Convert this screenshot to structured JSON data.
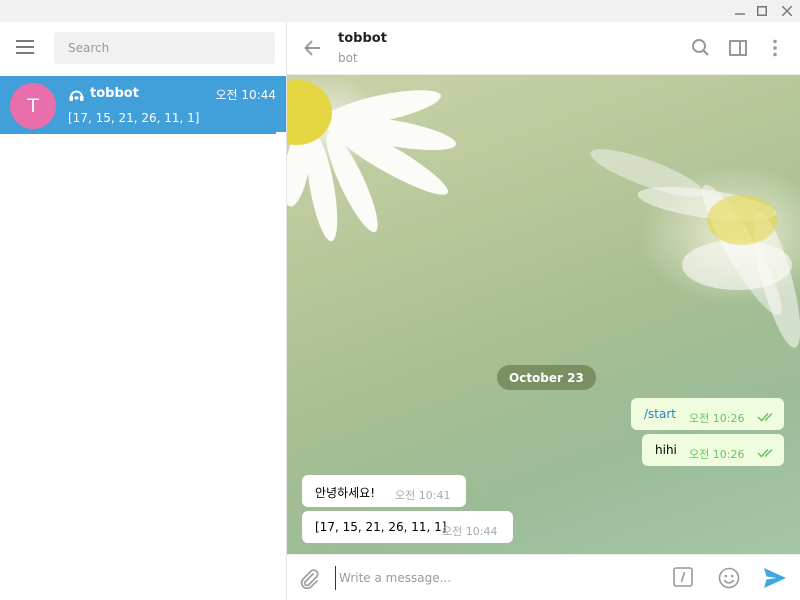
{
  "sidebar": {
    "search_placeholder": "Search",
    "chats": [
      {
        "avatar_letter": "T",
        "name": "tobbot",
        "time": "오전 10:44",
        "preview": "[17, 15, 21, 26, 11, 1]",
        "avatar_color": "#e86fac"
      }
    ]
  },
  "header": {
    "title": "tobbot",
    "subtitle": "bot"
  },
  "chat": {
    "date_label": "October 23",
    "messages": [
      {
        "direction": "out",
        "text": "/start",
        "time": "오전 10:26"
      },
      {
        "direction": "out",
        "text": "hihi",
        "time": "오전 10:26"
      },
      {
        "direction": "in",
        "text": "안녕하세요!",
        "time": "오전 10:41"
      },
      {
        "direction": "in",
        "text": "[17, 15, 21, 26, 11, 1]",
        "time": "오전 10:44"
      }
    ]
  },
  "composer": {
    "placeholder": "Write a message..."
  },
  "colors": {
    "accent": "#419fd9",
    "outgoing_bubble": "#effdde",
    "read_ticks": "#6cc264"
  },
  "icons": [
    "minimize-icon",
    "maximize-icon",
    "close-icon",
    "menu-icon",
    "bot-icon",
    "back-arrow-icon",
    "search-icon",
    "sidebar-toggle-icon",
    "more-vertical-icon",
    "attach-icon",
    "slash-command-icon",
    "emoji-icon",
    "send-icon",
    "double-check-icon"
  ]
}
